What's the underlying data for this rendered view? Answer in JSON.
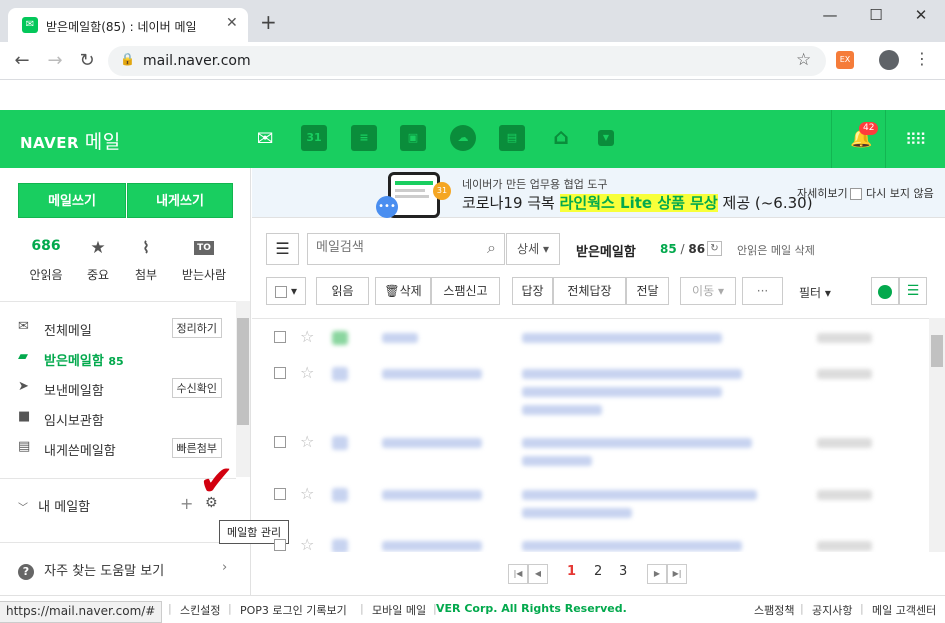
{
  "browser": {
    "tab_title": "받은메일함(85) : 네이버 메일",
    "url": "mail.naver.com",
    "extension_label": "EX",
    "status_url": "https://mail.naver.com/#"
  },
  "header": {
    "logo_naver": "NAVER",
    "logo_mail": "메일",
    "notification_count": "42",
    "service_icons": [
      "mail-icon",
      "calendar-icon",
      "contacts-list-icon",
      "address-book-icon",
      "cloud-icon",
      "memo-icon",
      "home-icon",
      "more-dropdown-icon"
    ],
    "calendar_day": "31"
  },
  "sidebar": {
    "write_button": "메일쓰기",
    "write_self_button": "내게쓰기",
    "counters": [
      {
        "value": "686",
        "label": "안읽음"
      },
      {
        "value": "",
        "label": "중요"
      },
      {
        "value": "",
        "label": "첨부"
      },
      {
        "value": "TO",
        "label": "받는사람"
      }
    ],
    "folders": [
      {
        "label": "전체메일",
        "tag": "정리하기"
      },
      {
        "label": "받은메일함",
        "count": "85"
      },
      {
        "label": "보낸메일함",
        "tag": "수신확인"
      },
      {
        "label": "임시보관함"
      },
      {
        "label": "내게쓴메일함",
        "tag": "빠른첨부"
      }
    ],
    "my_mailbox": "내 메일함",
    "manage_tooltip": "메일함 관리",
    "help_link": "자주 찾는 도움말 보기"
  },
  "banner": {
    "line1": "네이버가 만든 업무용 협업 도구",
    "line2_before": "코로나19 극복 ",
    "line2_highlight": "라인웍스 Lite 상품 무상",
    "line2_after": " 제공 (~6.30)",
    "details": "자세히보기",
    "hide": "다시 보지 않음",
    "calendar_day": "31"
  },
  "toolbar": {
    "search_placeholder": "메일검색",
    "detail": "상세",
    "box_title": "받은메일함",
    "unread": "85",
    "total": "86",
    "delete_unread": "안읽은 메일 삭제",
    "read": "읽음",
    "delete": "삭제",
    "spam": "스팸신고",
    "reply": "답장",
    "reply_all": "전체답장",
    "forward": "전달",
    "move": "이동",
    "more": "···",
    "filter": "필터"
  },
  "pagination": {
    "pages": [
      "1",
      "2",
      "3"
    ],
    "current": "1"
  },
  "footer": {
    "items": [
      "설정",
      "스킨설정",
      "POP3 로그인 기록보기",
      "모바일 메일",
      "VER Corp. All Rights Reserved."
    ],
    "right": [
      "스팸정책",
      "공지사항",
      "메일 고객센터"
    ]
  },
  "colors": {
    "naver_green": "#19ce60",
    "accent_green": "#03a94d",
    "banner_bg": "#eef5fb"
  }
}
